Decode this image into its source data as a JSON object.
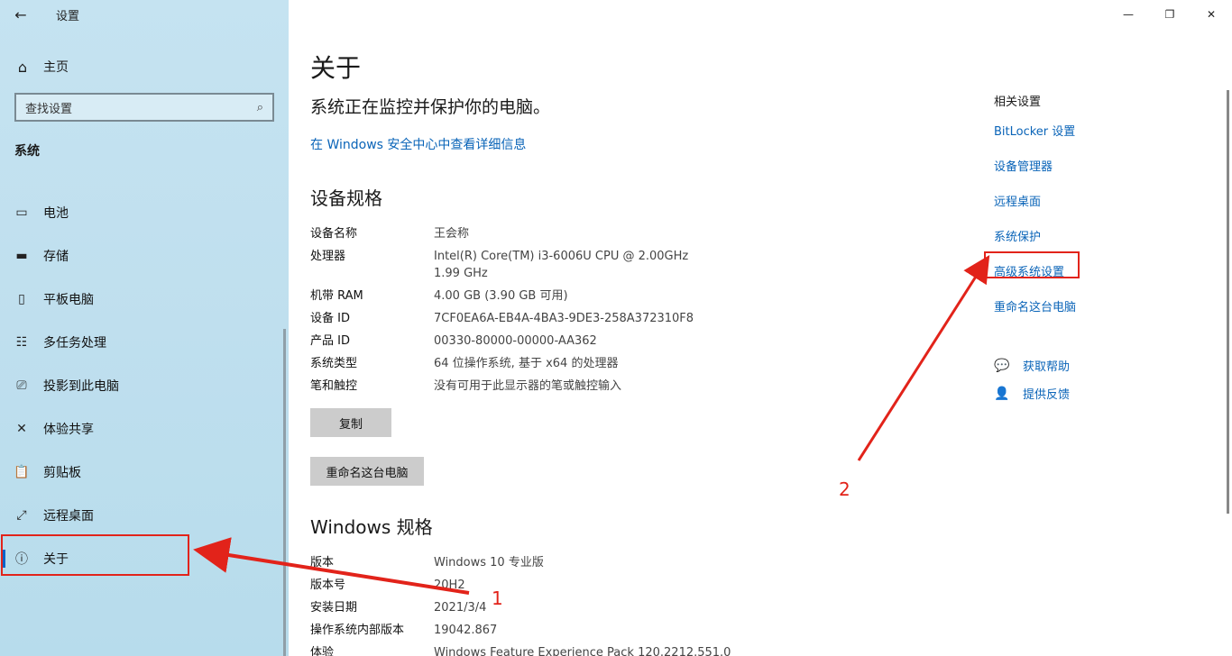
{
  "window": {
    "title": "设置",
    "minimize": "—",
    "maximize": "❐",
    "close": "✕"
  },
  "sidebar": {
    "back_icon": "←",
    "home_icon": "⌂",
    "home_label": "主页",
    "search_placeholder": "查找设置",
    "search_icon": "⌕",
    "section": "系统",
    "items": [
      {
        "icon": "▭",
        "label": "电池"
      },
      {
        "icon": "▬",
        "label": "存储"
      },
      {
        "icon": "▯",
        "label": "平板电脑"
      },
      {
        "icon": "☷",
        "label": "多任务处理"
      },
      {
        "icon": "⎚",
        "label": "投影到此电脑"
      },
      {
        "icon": "✕",
        "label": "体验共享"
      },
      {
        "icon": "📋",
        "label": "剪贴板"
      },
      {
        "icon": "⤢",
        "label": "远程桌面"
      },
      {
        "icon": "ⓘ",
        "label": "关于"
      }
    ]
  },
  "main": {
    "title": "关于",
    "status": "系统正在监控并保护你的电脑。",
    "security_link": "在 Windows 安全中心中查看详细信息",
    "device_specs": {
      "heading": "设备规格",
      "rows": [
        {
          "k": "设备名称",
          "v": "王会称"
        },
        {
          "k": "处理器",
          "v": "Intel(R) Core(TM) i3-6006U CPU @ 2.00GHz   1.99 GHz"
        },
        {
          "k": "机带 RAM",
          "v": "4.00 GB (3.90 GB 可用)"
        },
        {
          "k": "设备 ID",
          "v": "7CF0EA6A-EB4A-4BA3-9DE3-258A372310F8"
        },
        {
          "k": "产品 ID",
          "v": "00330-80000-00000-AA362"
        },
        {
          "k": "系统类型",
          "v": "64 位操作系统, 基于 x64 的处理器"
        },
        {
          "k": "笔和触控",
          "v": "没有可用于此显示器的笔或触控输入"
        }
      ],
      "copy_button": "复制",
      "rename_button": "重命名这台电脑"
    },
    "windows_specs": {
      "heading": "Windows 规格",
      "rows": [
        {
          "k": "版本",
          "v": "Windows 10 专业版"
        },
        {
          "k": "版本号",
          "v": "20H2"
        },
        {
          "k": "安装日期",
          "v": "2021/3/4"
        },
        {
          "k": "操作系统内部版本",
          "v": "19042.867"
        },
        {
          "k": "体验",
          "v": "Windows Feature Experience Pack 120.2212.551.0"
        }
      ]
    }
  },
  "related": {
    "heading": "相关设置",
    "links": [
      "BitLocker 设置",
      "设备管理器",
      "远程桌面",
      "系统保护",
      "高级系统设置",
      "重命名这台电脑"
    ],
    "help": {
      "icon": "💬",
      "label": "获取帮助"
    },
    "feedback": {
      "icon": "👤",
      "label": "提供反馈"
    }
  },
  "annotations": {
    "label_1": "1",
    "label_2": "2",
    "color": "#e2231a"
  }
}
